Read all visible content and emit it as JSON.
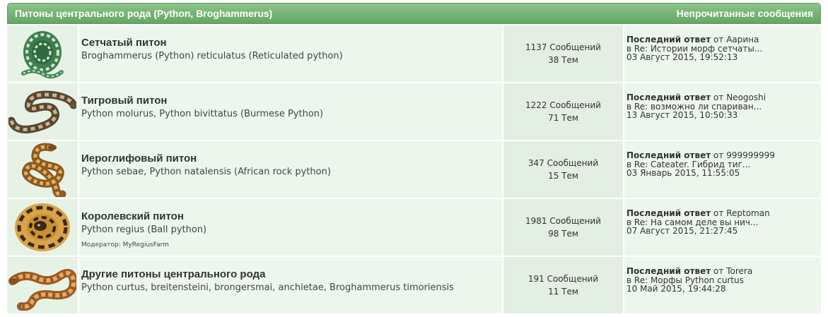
{
  "header": {
    "title": "Питоны центрального рода (Python, Broghammerus)",
    "unread_link": "Непрочитанные сообщения"
  },
  "forums": [
    {
      "icon": "green-coiled-python-icon",
      "title": "Сетчатый питон",
      "description": "Broghammerus (Python) reticulatus (Reticulated python)",
      "posts": "1137 Сообщений",
      "topics": "38 Тем",
      "last_label": "Последний ответ",
      "last_from": "от",
      "last_user": "Аарина",
      "last_in": "в",
      "last_topic": "Re: Истории морф сетчаты...",
      "last_date": "03 Август 2015, 19:52:13"
    },
    {
      "icon": "tiger-python-icon",
      "title": "Тигровый питон",
      "description": "Python molurus, Python bivittatus (Burmese Python)",
      "posts": "1222 Сообщений",
      "topics": "71 Тем",
      "last_label": "Последний ответ",
      "last_from": "от",
      "last_user": "Neogoshi",
      "last_in": "в",
      "last_topic": "Re: возможно ли спариван...",
      "last_date": "13 Август 2015, 10:50:33"
    },
    {
      "icon": "rock-python-icon",
      "title": "Иероглифовый питон",
      "description": "Python sebae, Python natalensis (African rock python)",
      "posts": "347 Сообщений",
      "topics": "15 Тем",
      "last_label": "Последний ответ",
      "last_from": "от",
      "last_user": "999999999",
      "last_in": "в",
      "last_topic": "Re: Cateater. Гибрид тиг...",
      "last_date": "03 Январь 2015, 11:55:05"
    },
    {
      "icon": "ball-python-icon",
      "title": "Королевский питон",
      "description": "Python regius (Ball python)",
      "moderator_label": "Модератор:",
      "moderator": "MyRegiusFarm",
      "posts": "1981 Сообщений",
      "topics": "98 Тем",
      "last_label": "Последний ответ",
      "last_from": "от",
      "last_user": "Reptoman",
      "last_in": "в",
      "last_topic": "Re: На самом деле вы нич...",
      "last_date": "07 Август 2015, 21:27:45"
    },
    {
      "icon": "blood-python-icon",
      "title": "Другие питоны центрального рода",
      "description": "Python curtus, breitensteini, brongersmai, anchietae, Broghammerus timoriensis",
      "posts": "191 Сообщений",
      "topics": "11 Тем",
      "last_label": "Последний ответ",
      "last_from": "от",
      "last_user": "Torera",
      "last_in": "в",
      "last_topic": "Re: Морфы Python curtus",
      "last_date": "10 Май 2015, 19:44:28"
    }
  ]
}
